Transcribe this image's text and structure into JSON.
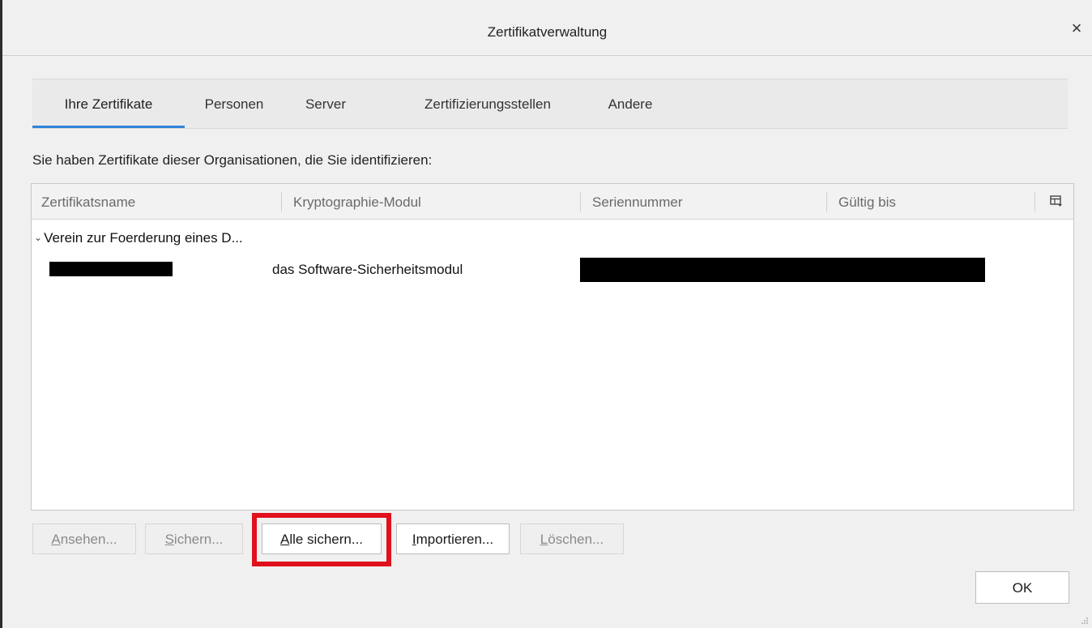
{
  "window": {
    "title": "Zertifikatverwaltung",
    "close_glyph": "×"
  },
  "tabs": [
    {
      "label": "Ihre Zertifikate",
      "active": true
    },
    {
      "label": "Personen",
      "active": false
    },
    {
      "label": "Server",
      "active": false
    },
    {
      "label": "Zertifizierungsstellen",
      "active": false
    },
    {
      "label": "Andere",
      "active": false
    }
  ],
  "description": "Sie haben Zertifikate dieser Organisationen, die Sie identifizieren:",
  "table": {
    "columns": [
      "Zertifikatsname",
      "Kryptographie-Modul",
      "Seriennummer",
      "Gültig bis"
    ],
    "group": {
      "label": "Verein zur Foerderung eines D...",
      "expanded": true
    },
    "rows": [
      {
        "name": "[redacted]",
        "module": "das Software-Sicherheitsmodul",
        "serial": "[redacted]",
        "valid_until": ""
      }
    ]
  },
  "buttons": {
    "view": {
      "mnemonic": "A",
      "rest": "nsehen...",
      "enabled": false
    },
    "backup": {
      "mnemonic": "S",
      "rest": "ichern...",
      "enabled": false
    },
    "backup_all": {
      "mnemonic": "A",
      "rest": "lle sichern...",
      "enabled": true,
      "highlighted": true
    },
    "import": {
      "mnemonic": "I",
      "rest": "mportieren...",
      "enabled": true
    },
    "delete": {
      "mnemonic": "L",
      "rest": "öschen...",
      "enabled": false
    }
  },
  "ok_label": "OK",
  "colors": {
    "accent": "#2f84d8",
    "highlight": "#e0101d"
  }
}
